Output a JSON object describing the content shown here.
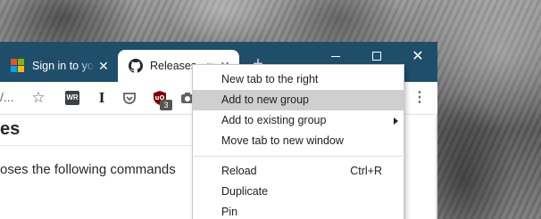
{
  "browser": {
    "tabs": [
      {
        "title": "Sign in to yo",
        "favicon": "microsoft-icon",
        "close": "✕"
      },
      {
        "title": "Releases · m",
        "favicon": "github-icon",
        "close": "✕"
      }
    ],
    "new_tab_symbol": "+",
    "window_controls": {
      "close_symbol": "✕"
    },
    "toolbar": {
      "url_fragment": "/...",
      "star_symbol": "☆",
      "ext_wr_label": "WR",
      "ext_i_label": "I",
      "ublock_badge": "3",
      "more_symbol": "⋮"
    },
    "page": {
      "heading": "es",
      "text": "oses the following commands"
    }
  },
  "context_menu": {
    "items": [
      {
        "label": "New tab to the right",
        "shortcut": "",
        "submenu": false,
        "highlighted": false
      },
      {
        "label": "Add to new group",
        "shortcut": "",
        "submenu": false,
        "highlighted": true
      },
      {
        "label": "Add to existing group",
        "shortcut": "",
        "submenu": true,
        "highlighted": false
      },
      {
        "label": "Move tab to new window",
        "shortcut": "",
        "submenu": false,
        "highlighted": false
      },
      {
        "label": "Reload",
        "shortcut": "Ctrl+R",
        "submenu": false,
        "highlighted": false
      },
      {
        "label": "Duplicate",
        "shortcut": "",
        "submenu": false,
        "highlighted": false
      },
      {
        "label": "Pin",
        "shortcut": "",
        "submenu": false,
        "highlighted": false
      }
    ]
  },
  "colors": {
    "titlebar": "#1f4e6b",
    "menu_highlight": "#cfcfcf",
    "ublock_red": "#800000"
  }
}
